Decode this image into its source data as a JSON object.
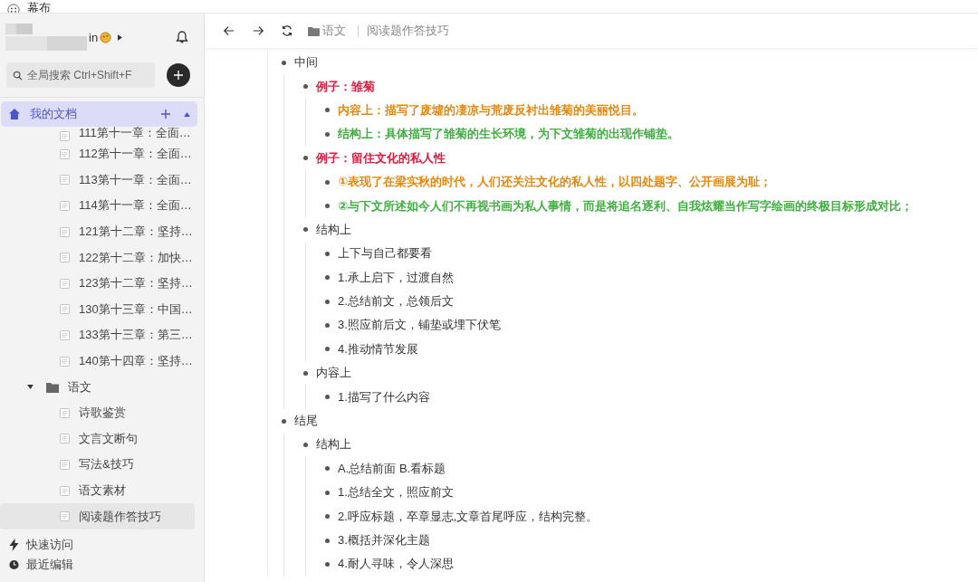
{
  "app": {
    "title": "幕布"
  },
  "user": {
    "name": "in"
  },
  "search": {
    "placeholder": "全局搜索 Ctrl+Shift+F"
  },
  "sidebar": {
    "root": {
      "label": "我的文档",
      "selected": true,
      "expanded": true
    },
    "items": [
      {
        "label": "111第十一章：全面…",
        "kind": "doc",
        "selected": false
      },
      {
        "label": "112第十一章：全面…",
        "kind": "doc",
        "selected": false
      },
      {
        "label": "113第十一章：全面…",
        "kind": "doc",
        "selected": false
      },
      {
        "label": "114第十一章：全面…",
        "kind": "doc",
        "selected": false
      },
      {
        "label": "121第十二章：坚持…",
        "kind": "doc",
        "selected": false
      },
      {
        "label": "122第十二章：加快…",
        "kind": "doc",
        "selected": false
      },
      {
        "label": "123第十二章：坚持…",
        "kind": "doc",
        "selected": false
      },
      {
        "label": "130第十三章：中国…",
        "kind": "doc",
        "selected": false
      },
      {
        "label": "133第十三章：第三…",
        "kind": "doc",
        "selected": false
      },
      {
        "label": "140第十四章：坚持…",
        "kind": "doc",
        "selected": false
      },
      {
        "label": "语文",
        "kind": "folder",
        "expanded": true,
        "selected": false,
        "children": [
          {
            "label": "诗歌鉴赏",
            "kind": "doc",
            "selected": false
          },
          {
            "label": "文言文断句",
            "kind": "doc",
            "selected": false
          },
          {
            "label": "写法&技巧",
            "kind": "doc",
            "selected": false
          },
          {
            "label": "语文素材",
            "kind": "doc",
            "selected": false
          },
          {
            "label": "阅读题作答技巧",
            "kind": "doc",
            "selected": true
          }
        ]
      }
    ],
    "footer": [
      {
        "label": "快速访问",
        "kind": "quick"
      },
      {
        "label": "最近编辑",
        "kind": "recent"
      }
    ]
  },
  "breadcrumb": {
    "folder": "语文",
    "document": "阅读题作答技巧"
  },
  "outline": [
    {
      "text": "中间",
      "children": [
        {
          "text": "例子：雏菊",
          "color": "#e8173c",
          "children": [
            {
              "text": "内容上：描写了废墟的凄凉与荒废反衬出雏菊的美丽悦目。",
              "color": "#e8870e"
            },
            {
              "text": "结构上：具体描写了雏菊的生长环境，为下文雏菊的出现作铺垫。",
              "color": "#3fb03f"
            }
          ]
        },
        {
          "text": "例子：留住文化的私人性",
          "color": "#e8173c",
          "children": [
            {
              "text": "①表现了在梁实秋的时代，人们还关注文化的私人性，以四处题字、公开画展为耻；",
              "color": "#e8870e"
            },
            {
              "text": "②与下文所述如今人们不再视书画为私人事情，而是将追名逐利、自我炫耀当作写字绘画的终极目标形成对比；",
              "color": "#3fb03f"
            }
          ]
        },
        {
          "text": "结构上",
          "children": [
            {
              "text": "上下与自己都要看"
            },
            {
              "text": "1.承上启下，过渡自然"
            },
            {
              "text": "2.总结前文，总领后文"
            },
            {
              "text": "3.照应前后文，铺垫或埋下伏笔"
            },
            {
              "text": "4.推动情节发展"
            }
          ]
        },
        {
          "text": "内容上",
          "children": [
            {
              "text": "1.描写了什么内容"
            }
          ]
        }
      ]
    },
    {
      "text": "结尾",
      "children": [
        {
          "text": "结构上",
          "children": [
            {
              "text": "A.总结前面 B.看标题"
            },
            {
              "text": "1.总结全文，照应前文"
            },
            {
              "text": "2.呼应标题，卒章显志,文章首尾呼应，结构完整。"
            },
            {
              "text": "3.概括并深化主题"
            },
            {
              "text": "4.耐人寻味，令人深思"
            }
          ]
        }
      ]
    }
  ]
}
